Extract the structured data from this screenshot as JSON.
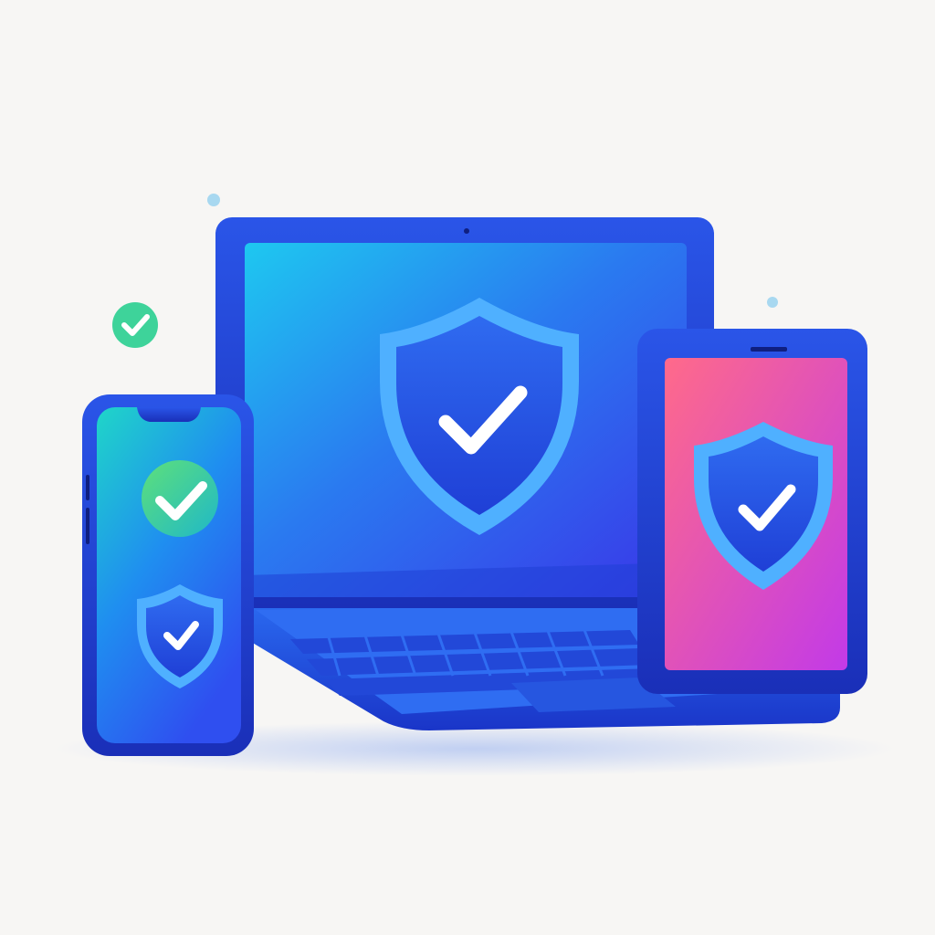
{
  "colors": {
    "background": "#f7f6f4",
    "device_frame": "#1f3fd6",
    "device_frame_dark": "#1a2fb8",
    "laptop_screen_start": "#1ec8f0",
    "laptop_screen_end": "#3a35e8",
    "phone_screen_start": "#1fd6c8",
    "phone_screen_end": "#2f4ff0",
    "tablet_screen_start": "#ff6a8a",
    "tablet_screen_end": "#c23ae8",
    "shield_fill": "#2656e8",
    "shield_outline": "#4fb0ff",
    "check_mark": "#ffffff",
    "success_badge": "#3ed39a",
    "accent_dot": "#a8d8f0"
  },
  "icons": {
    "laptop_shield": "shield-check-icon",
    "tablet_shield": "shield-check-icon",
    "phone_badge": "check-circle-icon",
    "phone_shield": "shield-check-icon",
    "floating_badge": "check-circle-icon"
  }
}
